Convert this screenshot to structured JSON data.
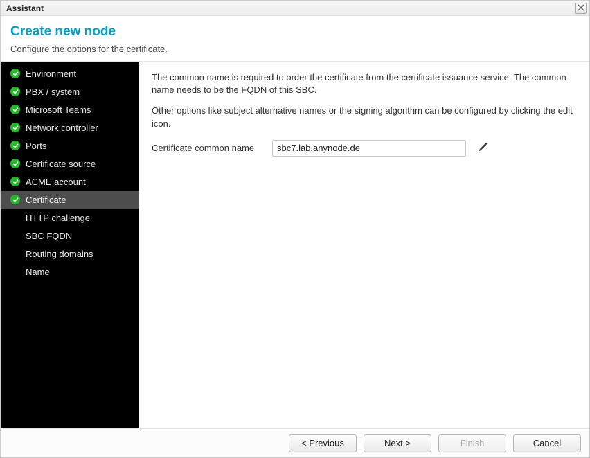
{
  "titlebar": {
    "title": "Assistant"
  },
  "header": {
    "title": "Create new node",
    "subtitle": "Configure the options for the certificate."
  },
  "sidebar": {
    "items": [
      {
        "label": "Environment",
        "completed": true,
        "active": false
      },
      {
        "label": "PBX / system",
        "completed": true,
        "active": false
      },
      {
        "label": "Microsoft Teams",
        "completed": true,
        "active": false
      },
      {
        "label": "Network controller",
        "completed": true,
        "active": false
      },
      {
        "label": "Ports",
        "completed": true,
        "active": false
      },
      {
        "label": "Certificate source",
        "completed": true,
        "active": false
      },
      {
        "label": "ACME account",
        "completed": true,
        "active": false
      },
      {
        "label": "Certificate",
        "completed": true,
        "active": true
      },
      {
        "label": "HTTP challenge",
        "completed": false,
        "active": false
      },
      {
        "label": "SBC FQDN",
        "completed": false,
        "active": false
      },
      {
        "label": "Routing domains",
        "completed": false,
        "active": false
      },
      {
        "label": "Name",
        "completed": false,
        "active": false
      }
    ]
  },
  "content": {
    "paragraph1": "The common name is required to order the certificate from the certificate issuance service. The common name needs to be the FQDN of this SBC.",
    "paragraph2": "Other options like subject alternative names or the signing algorithm can be configured by clicking the edit icon.",
    "form": {
      "common_name_label": "Certificate common name",
      "common_name_value": "sbc7.lab.anynode.de"
    }
  },
  "footer": {
    "previous": "< Previous",
    "next": "Next >",
    "finish": "Finish",
    "cancel": "Cancel",
    "finish_enabled": false
  }
}
